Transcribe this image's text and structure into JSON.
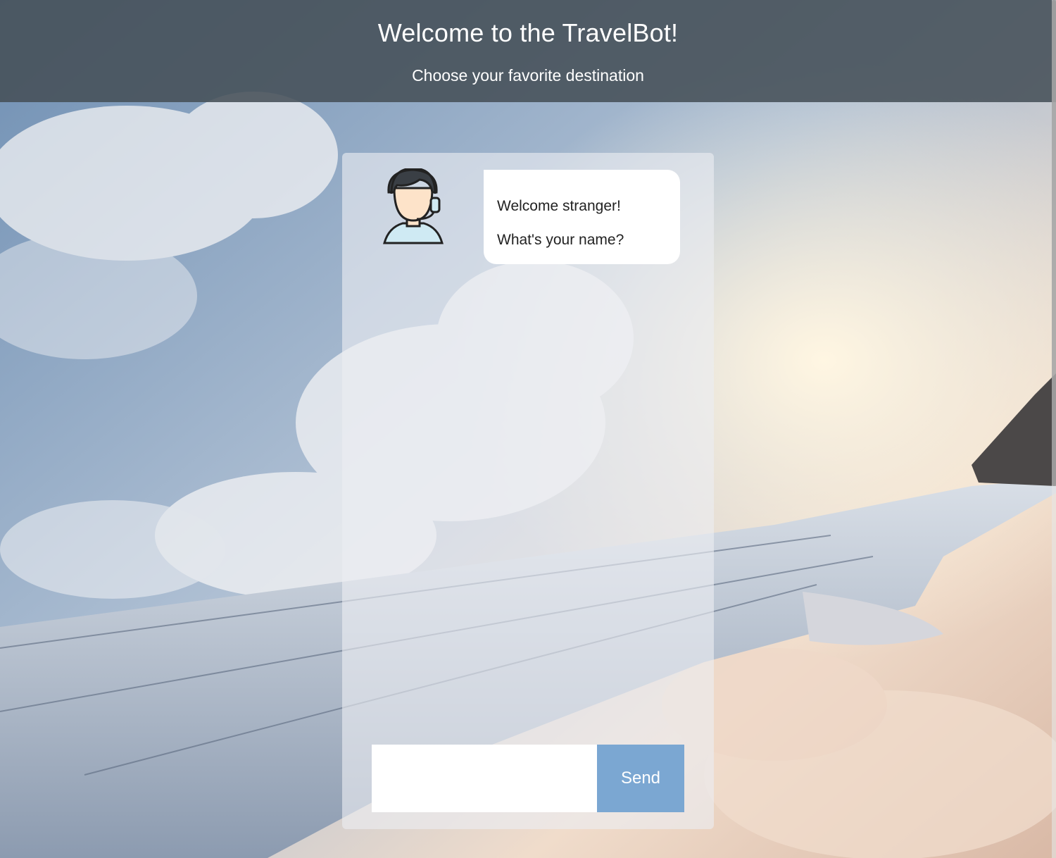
{
  "header": {
    "title": "Welcome to the TravelBot!",
    "subtitle": "Choose your favorite destination"
  },
  "chat": {
    "messages": [
      {
        "sender": "bot",
        "lines": [
          "Welcome stranger!",
          "What's your name?"
        ]
      }
    ],
    "avatar_icon": "support-agent-headset-icon"
  },
  "composer": {
    "input_value": "",
    "input_placeholder": "",
    "send_label": "Send"
  },
  "colors": {
    "header_bg": "#465058",
    "send_button": "#7ba7d2",
    "panel_bg": "#eceef2",
    "bubble_bg": "#ffffff"
  }
}
